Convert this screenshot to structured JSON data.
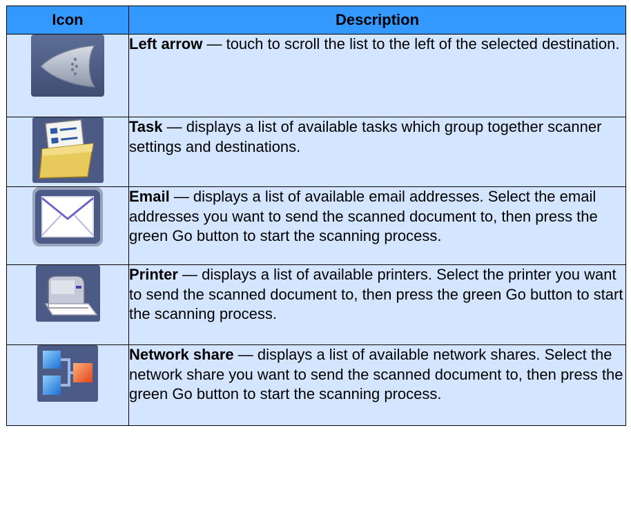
{
  "table": {
    "header_icon": "Icon",
    "header_description": "Description",
    "rows": [
      {
        "icon": "left-arrow-icon",
        "title": "Left arrow",
        "text": " — touch to scroll the list to the left of the selected destination."
      },
      {
        "icon": "task-folder-icon",
        "title": "Task",
        "text": " — displays a list of available tasks which group together scanner settings and destinations."
      },
      {
        "icon": "email-envelope-icon",
        "title": "Email",
        "text": " — displays a list of available email addresses. Select the email addresses you want to send the scanned document to, then press the green Go button to start the scanning process."
      },
      {
        "icon": "printer-icon",
        "title": "Printer",
        "text": " — displays a list of available printers. Select the printer you want to send the scanned document to, then press the green Go button to start the scanning process."
      },
      {
        "icon": "network-share-icon",
        "title": "Network share",
        "text": " — displays a list of available network shares. Select the network share you want to send the scanned document to, then press the green Go button to start the scanning process."
      }
    ]
  },
  "colors": {
    "header_bg": "#3399ff",
    "row_bg": "#d4e6ff",
    "border": "#000000"
  }
}
